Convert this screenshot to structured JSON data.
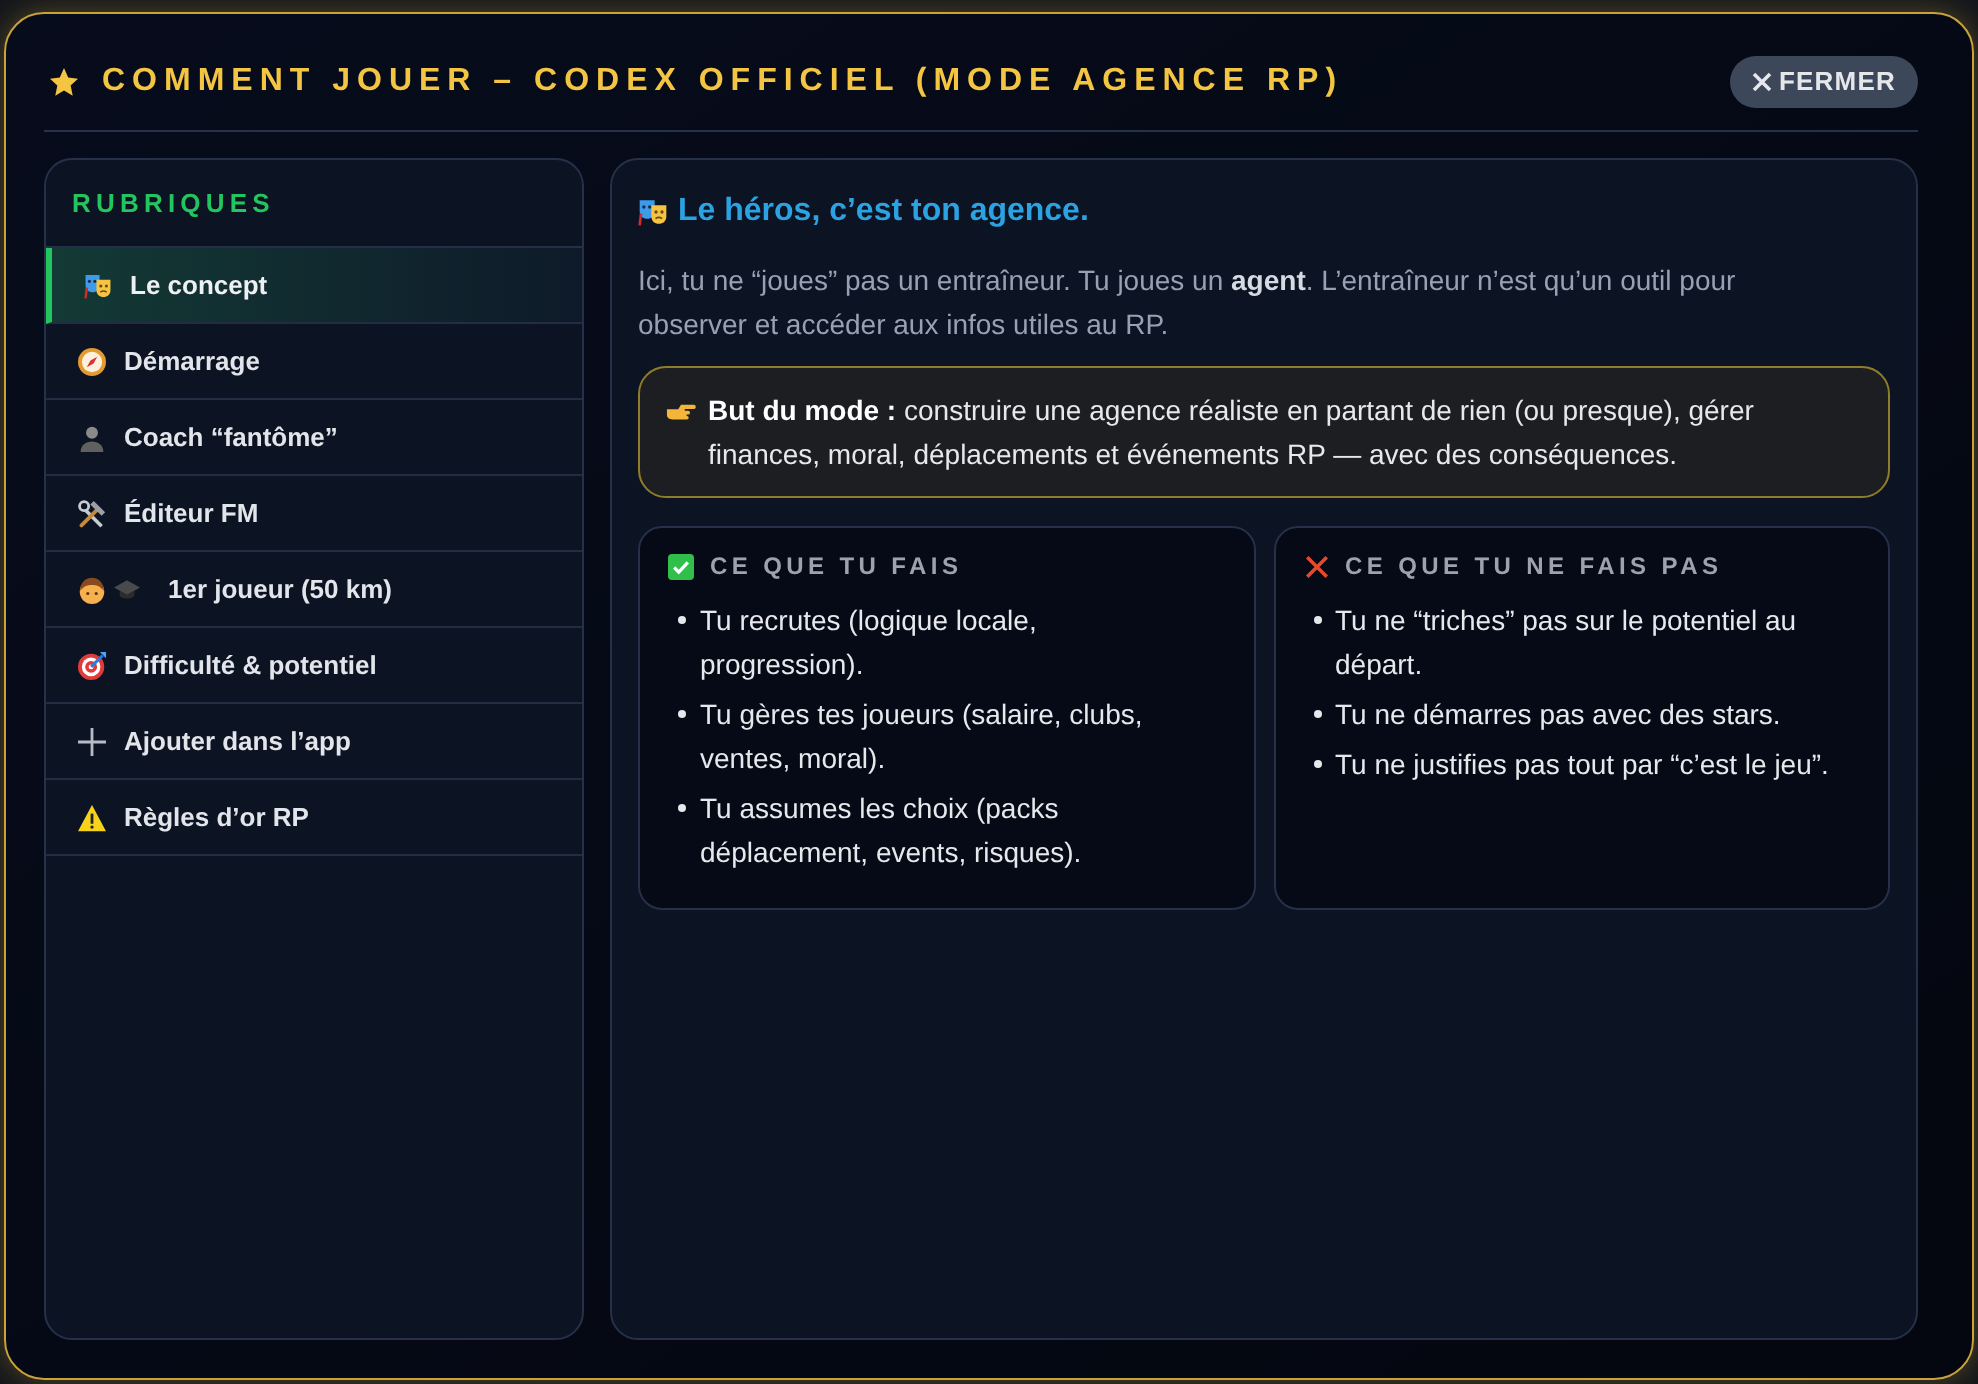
{
  "window": {
    "title": "COMMENT JOUER – CODEX OFFICIEL (MODE AGENCE RP)",
    "close_button": "FERMER"
  },
  "sidebar": {
    "heading": "RUBRIQUES",
    "items": [
      {
        "label": "Le concept",
        "selected": true
      },
      {
        "label": "Démarrage",
        "selected": false
      },
      {
        "label": "Coach “fantôme”",
        "selected": false
      },
      {
        "label": "Éditeur FM",
        "selected": false
      },
      {
        "label": "1er joueur (50 km)",
        "selected": false
      },
      {
        "label": "Difficulté & potentiel",
        "selected": false
      },
      {
        "label": "Ajouter dans l’app",
        "selected": false
      },
      {
        "label": "Règles d’or RP",
        "selected": false
      }
    ]
  },
  "content": {
    "heading": "Le héros, c’est ton agence.",
    "intro": "Ici, tu ne “joues” pas un entraîneur. Tu joues un **agent**. L’entraîneur n’est qu’un outil pour observer et accéder aux infos utiles au RP.",
    "callout": "**But du mode :** construire une agence réaliste en partant de rien (ou presque), gérer finances, moral, déplacements et événements RP — avec des conséquences.",
    "columns": [
      {
        "kind": "do",
        "title": "CE QUE TU FAIS",
        "items": [
          "Tu recrutes (logique locale, progression).",
          "Tu gères tes joueurs (salaire, clubs, ventes, moral).",
          "Tu assumes les choix (packs déplacement, events, risques)."
        ]
      },
      {
        "kind": "dont",
        "title": "CE QUE TU NE FAIS PAS",
        "items": [
          "Tu ne “triches” pas sur le potentiel au départ.",
          "Tu ne démarres pas avec des stars.",
          "Tu ne justifies pas tout par “c’est le jeu”."
        ]
      }
    ]
  }
}
